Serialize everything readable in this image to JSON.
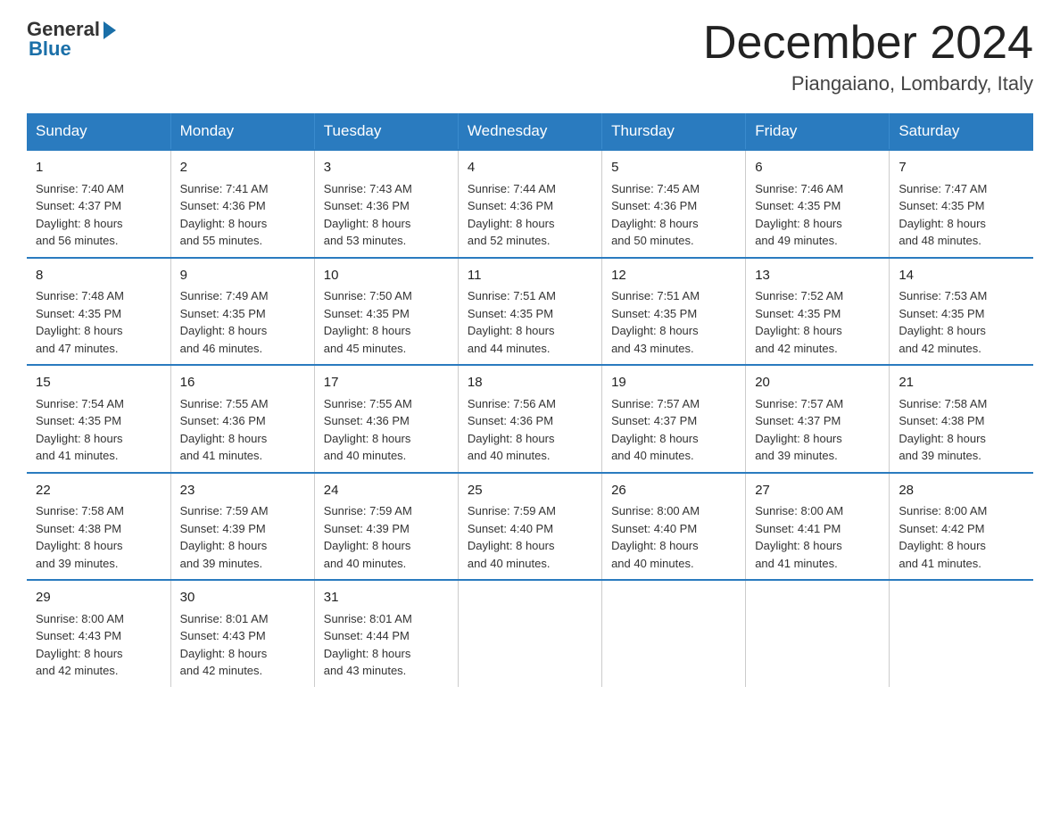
{
  "logo": {
    "general": "General",
    "blue": "Blue"
  },
  "title": "December 2024",
  "location": "Piangaiano, Lombardy, Italy",
  "days_of_week": [
    "Sunday",
    "Monday",
    "Tuesday",
    "Wednesday",
    "Thursday",
    "Friday",
    "Saturday"
  ],
  "weeks": [
    [
      {
        "day": "1",
        "sunrise": "7:40 AM",
        "sunset": "4:37 PM",
        "daylight": "8 hours and 56 minutes."
      },
      {
        "day": "2",
        "sunrise": "7:41 AM",
        "sunset": "4:36 PM",
        "daylight": "8 hours and 55 minutes."
      },
      {
        "day": "3",
        "sunrise": "7:43 AM",
        "sunset": "4:36 PM",
        "daylight": "8 hours and 53 minutes."
      },
      {
        "day": "4",
        "sunrise": "7:44 AM",
        "sunset": "4:36 PM",
        "daylight": "8 hours and 52 minutes."
      },
      {
        "day": "5",
        "sunrise": "7:45 AM",
        "sunset": "4:36 PM",
        "daylight": "8 hours and 50 minutes."
      },
      {
        "day": "6",
        "sunrise": "7:46 AM",
        "sunset": "4:35 PM",
        "daylight": "8 hours and 49 minutes."
      },
      {
        "day": "7",
        "sunrise": "7:47 AM",
        "sunset": "4:35 PM",
        "daylight": "8 hours and 48 minutes."
      }
    ],
    [
      {
        "day": "8",
        "sunrise": "7:48 AM",
        "sunset": "4:35 PM",
        "daylight": "8 hours and 47 minutes."
      },
      {
        "day": "9",
        "sunrise": "7:49 AM",
        "sunset": "4:35 PM",
        "daylight": "8 hours and 46 minutes."
      },
      {
        "day": "10",
        "sunrise": "7:50 AM",
        "sunset": "4:35 PM",
        "daylight": "8 hours and 45 minutes."
      },
      {
        "day": "11",
        "sunrise": "7:51 AM",
        "sunset": "4:35 PM",
        "daylight": "8 hours and 44 minutes."
      },
      {
        "day": "12",
        "sunrise": "7:51 AM",
        "sunset": "4:35 PM",
        "daylight": "8 hours and 43 minutes."
      },
      {
        "day": "13",
        "sunrise": "7:52 AM",
        "sunset": "4:35 PM",
        "daylight": "8 hours and 42 minutes."
      },
      {
        "day": "14",
        "sunrise": "7:53 AM",
        "sunset": "4:35 PM",
        "daylight": "8 hours and 42 minutes."
      }
    ],
    [
      {
        "day": "15",
        "sunrise": "7:54 AM",
        "sunset": "4:35 PM",
        "daylight": "8 hours and 41 minutes."
      },
      {
        "day": "16",
        "sunrise": "7:55 AM",
        "sunset": "4:36 PM",
        "daylight": "8 hours and 41 minutes."
      },
      {
        "day": "17",
        "sunrise": "7:55 AM",
        "sunset": "4:36 PM",
        "daylight": "8 hours and 40 minutes."
      },
      {
        "day": "18",
        "sunrise": "7:56 AM",
        "sunset": "4:36 PM",
        "daylight": "8 hours and 40 minutes."
      },
      {
        "day": "19",
        "sunrise": "7:57 AM",
        "sunset": "4:37 PM",
        "daylight": "8 hours and 40 minutes."
      },
      {
        "day": "20",
        "sunrise": "7:57 AM",
        "sunset": "4:37 PM",
        "daylight": "8 hours and 39 minutes."
      },
      {
        "day": "21",
        "sunrise": "7:58 AM",
        "sunset": "4:38 PM",
        "daylight": "8 hours and 39 minutes."
      }
    ],
    [
      {
        "day": "22",
        "sunrise": "7:58 AM",
        "sunset": "4:38 PM",
        "daylight": "8 hours and 39 minutes."
      },
      {
        "day": "23",
        "sunrise": "7:59 AM",
        "sunset": "4:39 PM",
        "daylight": "8 hours and 39 minutes."
      },
      {
        "day": "24",
        "sunrise": "7:59 AM",
        "sunset": "4:39 PM",
        "daylight": "8 hours and 40 minutes."
      },
      {
        "day": "25",
        "sunrise": "7:59 AM",
        "sunset": "4:40 PM",
        "daylight": "8 hours and 40 minutes."
      },
      {
        "day": "26",
        "sunrise": "8:00 AM",
        "sunset": "4:40 PM",
        "daylight": "8 hours and 40 minutes."
      },
      {
        "day": "27",
        "sunrise": "8:00 AM",
        "sunset": "4:41 PM",
        "daylight": "8 hours and 41 minutes."
      },
      {
        "day": "28",
        "sunrise": "8:00 AM",
        "sunset": "4:42 PM",
        "daylight": "8 hours and 41 minutes."
      }
    ],
    [
      {
        "day": "29",
        "sunrise": "8:00 AM",
        "sunset": "4:43 PM",
        "daylight": "8 hours and 42 minutes."
      },
      {
        "day": "30",
        "sunrise": "8:01 AM",
        "sunset": "4:43 PM",
        "daylight": "8 hours and 42 minutes."
      },
      {
        "day": "31",
        "sunrise": "8:01 AM",
        "sunset": "4:44 PM",
        "daylight": "8 hours and 43 minutes."
      },
      null,
      null,
      null,
      null
    ]
  ],
  "labels": {
    "sunrise": "Sunrise:",
    "sunset": "Sunset:",
    "daylight": "Daylight:"
  }
}
